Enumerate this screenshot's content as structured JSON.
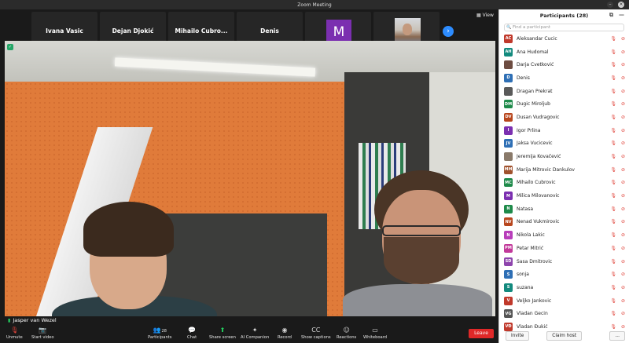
{
  "window": {
    "title": "Zoom Meeting"
  },
  "thumbnails": [
    {
      "display_name": "Ivana Vasic",
      "label": "Ivana Vasic",
      "muted": false,
      "kind": "name"
    },
    {
      "display_name": "Dejan Djokić",
      "label": "Dejan Djokić",
      "muted": false,
      "kind": "name"
    },
    {
      "display_name": "Mihailo Cubro...",
      "label": "Mihailo Cubrovic",
      "muted": true,
      "kind": "name"
    },
    {
      "display_name": "Denis",
      "label": "Denis",
      "muted": true,
      "kind": "name"
    },
    {
      "display_name": "M",
      "label": "Milica Milovanovic",
      "muted": true,
      "kind": "avatar",
      "color": "#7b2fb0"
    },
    {
      "display_name": "",
      "label": "Jeremija Kovačević",
      "muted": true,
      "kind": "photo"
    }
  ],
  "view_button": {
    "label": "View"
  },
  "main_video": {
    "speaker_label": "Jasper van Wezel"
  },
  "toolbar": {
    "items": [
      {
        "label": "Unmute",
        "icon": "mic-muted-icon"
      },
      {
        "label": "Start video",
        "icon": "video-off-icon"
      },
      {
        "label": "Participants",
        "icon": "participants-icon",
        "count": "28"
      },
      {
        "label": "Chat",
        "icon": "chat-icon"
      },
      {
        "label": "Share screen",
        "icon": "share-screen-icon"
      },
      {
        "label": "AI Companion",
        "icon": "ai-companion-icon"
      },
      {
        "label": "Record",
        "icon": "record-icon"
      },
      {
        "label": "Show captions",
        "icon": "captions-icon"
      },
      {
        "label": "Reactions",
        "icon": "reactions-icon"
      },
      {
        "label": "Whiteboard",
        "icon": "whiteboard-icon"
      }
    ],
    "leave_label": "Leave"
  },
  "panel": {
    "title": "Participants (28)",
    "search_placeholder": "Find a participant",
    "participants": [
      {
        "initials": "AC",
        "name": "Aleksandar Cucic",
        "color": "#c0392b"
      },
      {
        "initials": "AH",
        "name": "Ana Hudomal",
        "color": "#138a7e"
      },
      {
        "initials": "",
        "name": "Darja Cvetković",
        "color": "#6d4c41"
      },
      {
        "initials": "D",
        "name": "Denis",
        "color": "#2e6fb5"
      },
      {
        "initials": "",
        "name": "Dragan Prekrat",
        "color": "#5a5a5a"
      },
      {
        "initials": "DM",
        "name": "Dugic Miroljub",
        "color": "#1e8a4a"
      },
      {
        "initials": "DV",
        "name": "Dusan Vudragovic",
        "color": "#b8461d"
      },
      {
        "initials": "I",
        "name": "Igor Prlina",
        "color": "#7b2fb0"
      },
      {
        "initials": "JV",
        "name": "Jaksa Vucicevic",
        "color": "#2e6fb5"
      },
      {
        "initials": "",
        "name": "Jeremija Kovačević",
        "color": "#8a7a6a"
      },
      {
        "initials": "MM",
        "name": "Marija Mitrovic Dankulov",
        "color": "#a0522d"
      },
      {
        "initials": "MC",
        "name": "Mihailo Cubrovic",
        "color": "#1e8a4a"
      },
      {
        "initials": "M",
        "name": "Milica Milovanovic",
        "color": "#7b2fb0"
      },
      {
        "initials": "N",
        "name": "Natasa",
        "color": "#1e8a4a"
      },
      {
        "initials": "NV",
        "name": "Nenad Vukmirovic",
        "color": "#b8461d"
      },
      {
        "initials": "N",
        "name": "Nikola Lakic",
        "color": "#b83dba"
      },
      {
        "initials": "PM",
        "name": "Petar Mitrić",
        "color": "#c2399a"
      },
      {
        "initials": "SD",
        "name": "Sasa Dmitrovic",
        "color": "#8e44ad"
      },
      {
        "initials": "S",
        "name": "sonja",
        "color": "#2e6fb5"
      },
      {
        "initials": "S",
        "name": "suzana",
        "color": "#138a7e"
      },
      {
        "initials": "V",
        "name": "Veljko Jankovic",
        "color": "#c0392b"
      },
      {
        "initials": "VG",
        "name": "Vladan Gecin",
        "color": "#555555"
      },
      {
        "initials": "VĐ",
        "name": "Vladan Đukić",
        "color": "#c0392b"
      }
    ],
    "invite_label": "Invite",
    "claim_host_label": "Claim host",
    "more_label": "..."
  }
}
